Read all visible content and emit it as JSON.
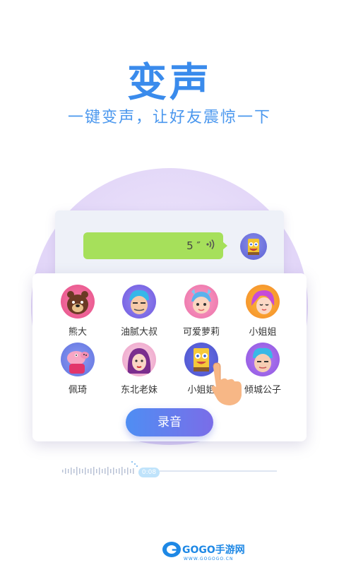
{
  "hero": {
    "title": "变声",
    "subtitle": "一键变声，让好友震惊一下"
  },
  "chat": {
    "duration": "5 ″",
    "wave_icon": "sound-wave-icon",
    "bubble_color": "#a6e05b"
  },
  "voices": [
    {
      "label": "熊大",
      "icon": "bear-avatar"
    },
    {
      "label": "油腻大叔",
      "icon": "uncle-avatar"
    },
    {
      "label": "可爱萝莉",
      "icon": "loli-avatar"
    },
    {
      "label": "小姐姐",
      "icon": "girl-avatar"
    },
    {
      "label": "佩琦",
      "icon": "pig-avatar"
    },
    {
      "label": "东北老妹",
      "icon": "northeast-girl-avatar"
    },
    {
      "label": "小姐姐",
      "icon": "sponge-avatar"
    },
    {
      "label": "倾城公子",
      "icon": "handsome-avatar"
    }
  ],
  "record_button": "录音",
  "timeline": {
    "time": "0:08"
  },
  "watermark": {
    "brand": "GOGO手游网",
    "url": "WWW.GOGOGO.CN"
  },
  "colors": {
    "accent": "#3a8bec",
    "button_from": "#4f8ef3",
    "button_to": "#7a6de8"
  }
}
